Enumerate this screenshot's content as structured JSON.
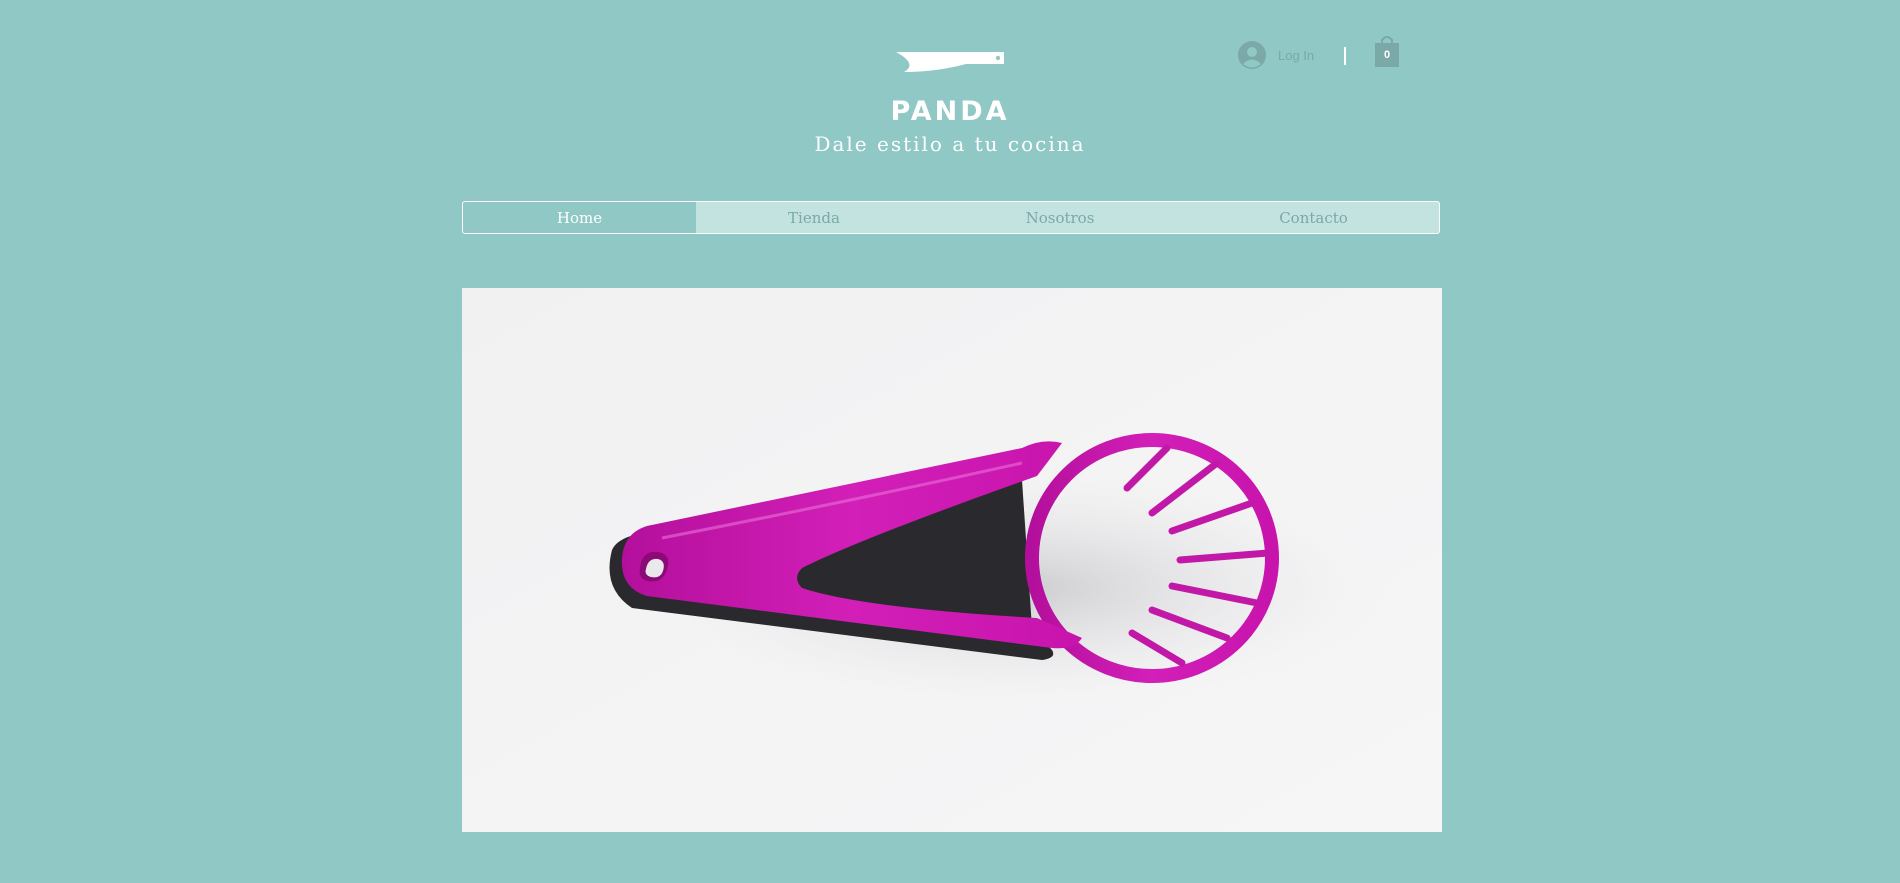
{
  "header": {
    "brand": "PANDA",
    "tagline": "Dale estilo a tu cocina",
    "logo_icon": "knife-icon"
  },
  "account": {
    "login_label": "Log In",
    "avatar_icon": "user-avatar-icon"
  },
  "cart": {
    "icon": "shopping-bag-icon",
    "count": "0"
  },
  "nav": {
    "items": [
      {
        "label": "Home",
        "active": true
      },
      {
        "label": "Tienda",
        "active": false
      },
      {
        "label": "Nosotros",
        "active": false
      },
      {
        "label": "Contacto",
        "active": false
      }
    ]
  },
  "colors": {
    "background": "#8fc8c5",
    "nav_inactive": "#c3e3e1",
    "nav_text": "#7aa9a7",
    "product_magenta": "#d21fb8"
  }
}
